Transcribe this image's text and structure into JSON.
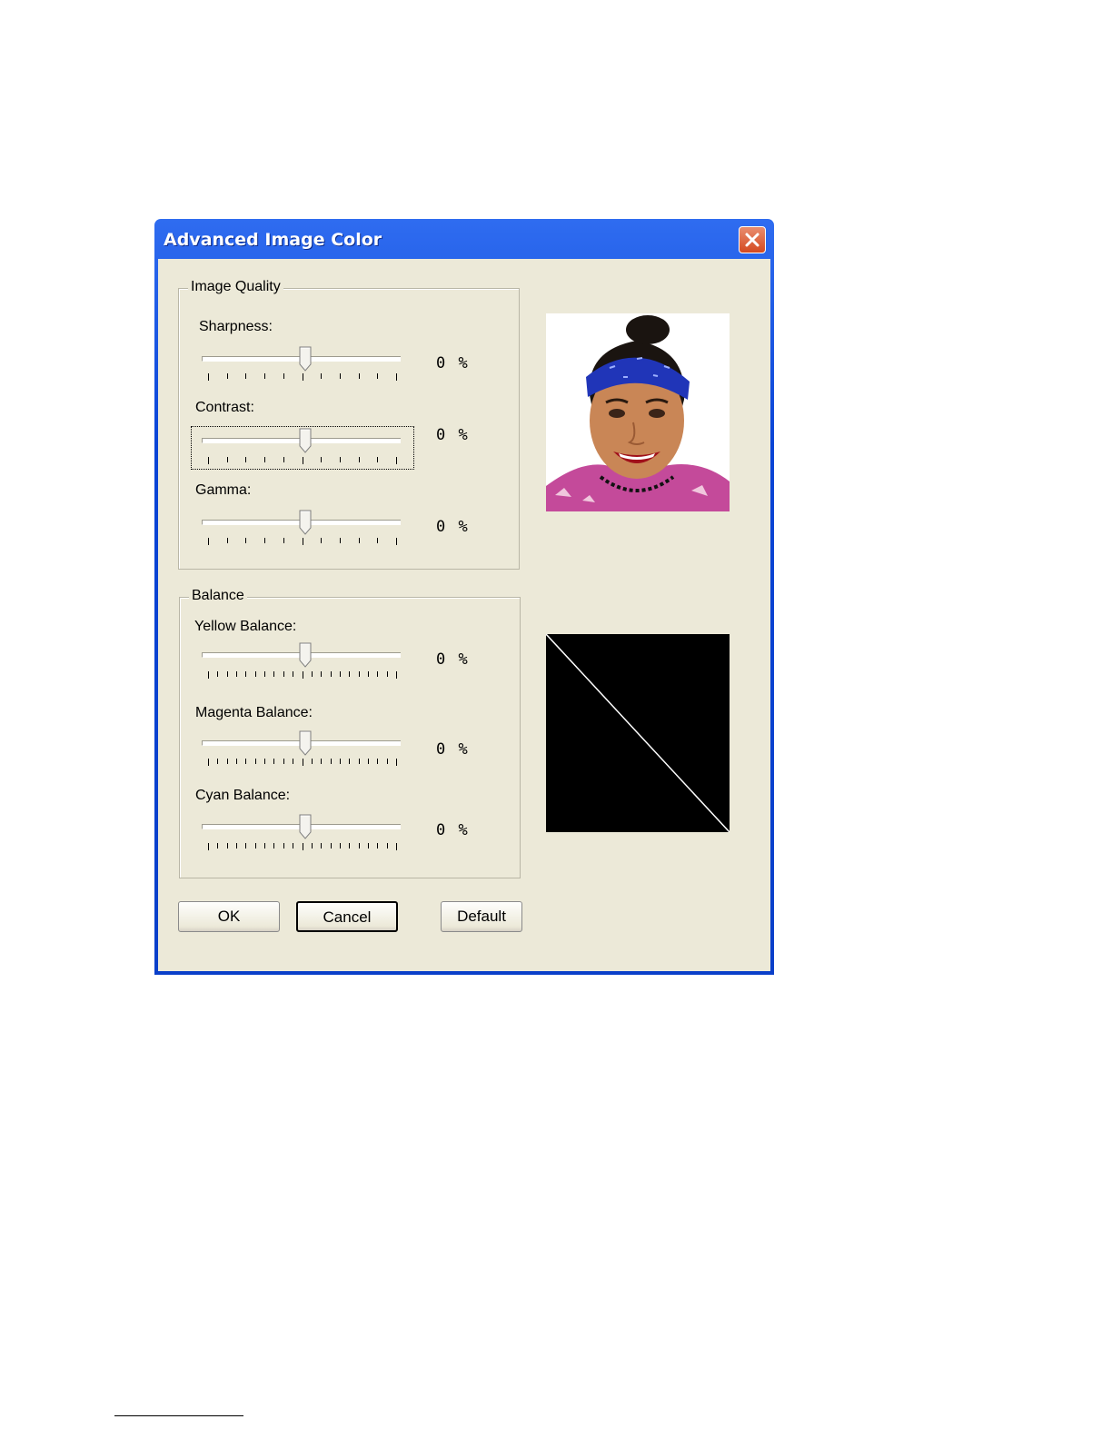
{
  "window": {
    "title": "Advanced Image Color",
    "close_icon": "close-icon"
  },
  "image_quality": {
    "legend": "Image Quality",
    "sliders": [
      {
        "label": "Sharpness:",
        "value_text": "0 %",
        "value": 0,
        "range": [
          -100,
          100
        ]
      },
      {
        "label": "Contrast:",
        "value_text": "0 %",
        "value": 0,
        "range": [
          -100,
          100
        ]
      },
      {
        "label": "Gamma:",
        "value_text": "0 %",
        "value": 0,
        "range": [
          -100,
          100
        ]
      }
    ]
  },
  "balance": {
    "legend": "Balance",
    "sliders": [
      {
        "label": "Yellow Balance:",
        "value_text": "0 %",
        "value": 0,
        "range": [
          -100,
          100
        ]
      },
      {
        "label": "Magenta Balance:",
        "value_text": "0 %",
        "value": 0,
        "range": [
          -100,
          100
        ]
      },
      {
        "label": "Cyan Balance:",
        "value_text": "0 %",
        "value": 0,
        "range": [
          -100,
          100
        ]
      }
    ]
  },
  "preview": {
    "photo_icon": "portrait-photo-icon",
    "curve_icon": "color-curve-icon"
  },
  "buttons": {
    "ok": "OK",
    "cancel": "Cancel",
    "default": "Default"
  },
  "colors": {
    "title_bar": "#0a44d6",
    "dialog_face": "#ece9d8",
    "close_button": "#d4491f"
  }
}
